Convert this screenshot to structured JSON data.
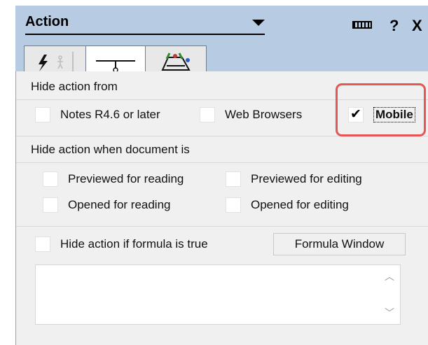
{
  "header": {
    "title": "Action",
    "help_glyph": "?",
    "close_glyph": "X",
    "icons": [
      "keyboard-icon",
      "help-icon",
      "close-icon"
    ]
  },
  "tabs": [
    {
      "name": "events",
      "icon": "lightning-icon"
    },
    {
      "name": "hide-when",
      "icon": "hide-when-icon",
      "active": true
    },
    {
      "name": "advanced",
      "icon": "gear-icon"
    }
  ],
  "hide_from": {
    "label": "Hide action from",
    "options": [
      {
        "label": "Notes R4.6 or later",
        "checked": false
      },
      {
        "label": "Web Browsers",
        "checked": false
      },
      {
        "label": "Mobile",
        "checked": true
      }
    ]
  },
  "hide_when_doc": {
    "label": "Hide action when document is",
    "options": [
      {
        "label": "Previewed for reading",
        "checked": false
      },
      {
        "label": "Previewed for editing",
        "checked": false
      },
      {
        "label": "Opened for reading",
        "checked": false
      },
      {
        "label": "Opened for editing",
        "checked": false
      }
    ]
  },
  "formula": {
    "checkbox_label": "Hide action if formula is true",
    "checked": false,
    "button_label": "Formula Window",
    "value": ""
  },
  "colors": {
    "header_bg": "#b7cbe2",
    "body_bg": "#f0f0f0",
    "highlight": "#e85555"
  }
}
